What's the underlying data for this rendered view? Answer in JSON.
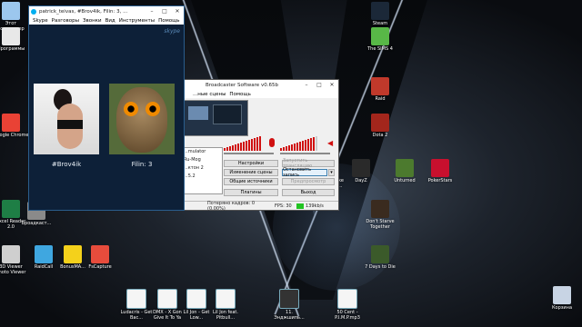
{
  "desktop": {
    "left_icons": [
      {
        "label": "Этот компьютер",
        "icon": "computer-icon",
        "color": "#9cc7ee"
      },
      {
        "label": "Программы",
        "icon": "folder-doc-icon",
        "color": "#e8e8e8"
      },
      {
        "label": "Google Chrome",
        "icon": "chrome-icon",
        "color": "#e94235"
      },
      {
        "label": "Excel Reader 2.0",
        "icon": "excel-icon",
        "color": "#1e7e45"
      },
      {
        "label": "3D Viewer Photo Viewer",
        "icon": "viewer-icon",
        "color": "#cfcfcf"
      },
      {
        "label": "RaidCall",
        "icon": "raidcall-icon",
        "color": "#3fa7e0"
      },
      {
        "label": "BonusMA...",
        "icon": "bonus-icon",
        "color": "#f4d11b"
      },
      {
        "label": "FsCapture",
        "icon": "fscapture-icon",
        "color": "#e74c3c"
      },
      {
        "label": "Броадкаст...",
        "icon": "broadcast-icon",
        "color": "#8a8a8a"
      }
    ],
    "right_icons": [
      {
        "label": "Steam",
        "icon": "steam-icon",
        "color": "#1b2838"
      },
      {
        "label": "The SIMS 4",
        "icon": "sims-icon",
        "color": "#58b847"
      },
      {
        "label": "Raid",
        "icon": "raid-icon",
        "color": "#c0392b"
      },
      {
        "label": "Dota 2",
        "icon": "dota-icon",
        "color": "#a3261c"
      },
      {
        "label": "Counter-Strike Global Offe...",
        "icon": "csgo-icon",
        "color": "#d8a24a"
      },
      {
        "label": "DayZ",
        "icon": "dayz-icon",
        "color": "#2a2a2a"
      },
      {
        "label": "Unturned",
        "icon": "unturned-icon",
        "color": "#4c7a2e"
      },
      {
        "label": "PokerStars",
        "icon": "pokerstars-icon",
        "color": "#c8102e"
      },
      {
        "label": "Don't Starve Together",
        "icon": "dst-icon",
        "color": "#3a2b1f"
      },
      {
        "label": "7 Days to Die",
        "icon": "7days-icon",
        "color": "#3b5a2a"
      },
      {
        "label": "Корзина",
        "icon": "recycle-bin-icon",
        "color": "#c8d4e4"
      }
    ],
    "bottom_icons": [
      {
        "label": "Ludacris - Get Bac...",
        "icon": "audio-file-icon"
      },
      {
        "label": "DMX - X Gon Give It To Ya",
        "icon": "audio-file-icon"
      },
      {
        "label": "Lil Jon - Get Low...",
        "icon": "audio-file-icon"
      },
      {
        "label": "Lil Jon feat. Pitbull...",
        "icon": "audio-file-icon"
      },
      {
        "label": "11. Энджшипь...",
        "icon": "video-file-icon"
      },
      {
        "label": "50 Cent - P.I.M.P.mp3",
        "icon": "audio-file-icon"
      }
    ]
  },
  "skype": {
    "title": "patrick_teivas, #Brov4ik, Filin: 3, ...",
    "menu": [
      "Skype",
      "Разговоры",
      "Звонки",
      "Вид",
      "Инструменты",
      "Помощь"
    ],
    "brand": "skype",
    "participants": [
      {
        "name": "#Brov4ik"
      },
      {
        "name": "Filin: 3"
      }
    ]
  },
  "obs": {
    "title": "Broadcaster Software v0.65b",
    "menu": [
      "...ные сцены",
      "Помощь"
    ],
    "side_items": [
      "...mulator",
      "Ru-Mog",
      "...ктон 2",
      "...5.2"
    ],
    "buttons": {
      "settings": "Настройки",
      "start_stream": "Запустить трансляцию",
      "edit_scene": "Изменение сцены",
      "stop_record": "Остановить запись",
      "global_sources": "Общие источники",
      "preview": "Предпросмотр",
      "plugins": "Плагины",
      "exit": "Выход"
    },
    "status": {
      "dropped": "Потеряно кадров: 0 (0.00%)",
      "fps": "FPS: 30",
      "bitrate": "139kb/s"
    },
    "accent": "#22c322",
    "meter_left_level": 0.95,
    "meter_right_level": 0.9
  }
}
